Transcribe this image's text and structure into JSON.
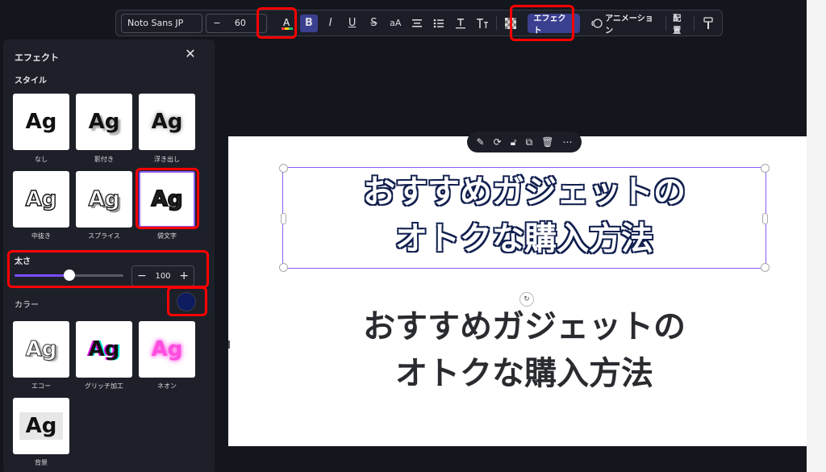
{
  "toolbar": {
    "font_name": "Noto Sans JP",
    "size_minus": "−",
    "font_size": "60",
    "effects_label": "エフェクト",
    "animation_label": "アニメーション",
    "position_label": "配置",
    "case_label": "aA"
  },
  "panel": {
    "title": "エフェクト",
    "style_heading": "スタイル",
    "styles": [
      {
        "label": "なし",
        "sample": "Ag"
      },
      {
        "label": "影付き",
        "sample": "Ag"
      },
      {
        "label": "浮き出し",
        "sample": "Ag"
      },
      {
        "label": "中抜き",
        "sample": "Ag"
      },
      {
        "label": "スプライス",
        "sample": "Ag"
      },
      {
        "label": "袋文字",
        "sample": "Ag"
      },
      {
        "label": "エコー",
        "sample": "Ag"
      },
      {
        "label": "グリッチ加工",
        "sample": "Ag"
      },
      {
        "label": "ネオン",
        "sample": "Ag"
      },
      {
        "label": "背景",
        "sample": "Ag"
      }
    ],
    "thickness_label": "太さ",
    "thickness_value": "100",
    "thickness_fraction": 0.5,
    "color_label": "カラー",
    "color_value": "#0d1c5e",
    "minus": "−",
    "plus": "+"
  },
  "canvas": {
    "heading_line1": "おすすめガジェットの",
    "heading_line2": "オトクな購入方法",
    "plain_line1": "おすすめガジェットの",
    "plain_line2": "オトクな購入方法"
  }
}
